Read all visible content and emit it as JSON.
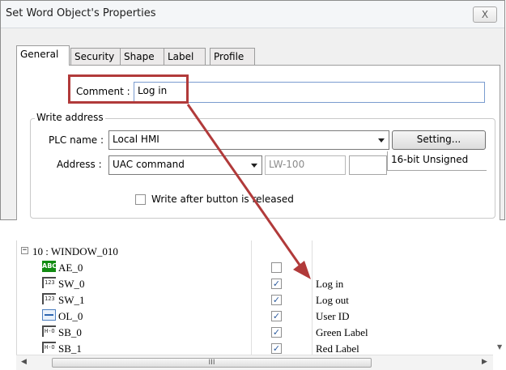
{
  "window": {
    "title": "Set Word Object's Properties",
    "close_label": "X"
  },
  "tabs": [
    {
      "label": "General",
      "active": true
    },
    {
      "label": "Security",
      "active": false
    },
    {
      "label": "Shape",
      "active": false
    },
    {
      "label": "Label",
      "active": false
    },
    {
      "label": "Profile",
      "active": false
    }
  ],
  "general": {
    "comment_label": "Comment :",
    "comment_value": "Log in",
    "write_address_legend": "Write address",
    "plc_label": "PLC name :",
    "plc_value": "Local HMI",
    "setting_button": "Setting...",
    "address_label": "Address :",
    "address_type": "UAC command",
    "address_value": "LW-100",
    "data_format": "16-bit Unsigned",
    "write_after_release_label": "Write after button is released",
    "write_after_release_checked": false
  },
  "tree": {
    "root_label": "10 : WINDOW_010",
    "expander": "−",
    "rows": [
      {
        "icon": "abc-display-icon",
        "icon_text": "ABC",
        "name": "AE_0",
        "checked": false,
        "value": ""
      },
      {
        "icon": "switch-icon",
        "icon_text": "123",
        "name": "SW_0",
        "checked": true,
        "value": "Log in"
      },
      {
        "icon": "switch-icon",
        "icon_text": "123",
        "name": "SW_1",
        "checked": true,
        "value": "Log out"
      },
      {
        "icon": "option-list-icon",
        "icon_text": "",
        "name": "OL_0",
        "checked": true,
        "value": "User ID"
      },
      {
        "icon": "set-bit-icon",
        "icon_text": "H-O",
        "name": "SB_0",
        "checked": true,
        "value": "Green Label"
      },
      {
        "icon": "set-bit-icon",
        "icon_text": "H-O",
        "name": "SB_1",
        "checked": true,
        "value": "Red Label"
      }
    ],
    "scroll_thumb_grip": "III",
    "check_glyph": "✓"
  },
  "colors": {
    "highlight": "#b13a3a",
    "dialog_bg": "#f0f0f0",
    "field_border": "#7a9ccf"
  }
}
